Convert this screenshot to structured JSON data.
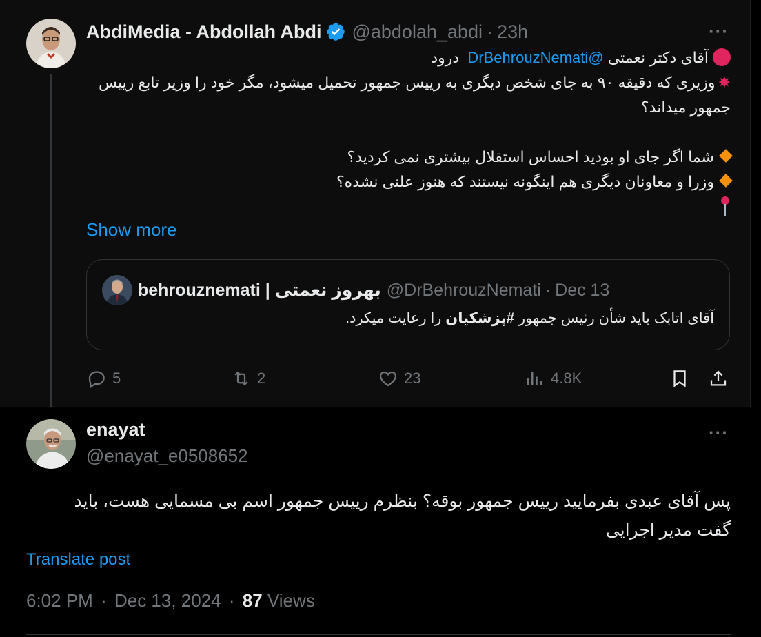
{
  "tweet": {
    "author_name": "AbdiMedia - Abdollah Abdi",
    "handle": "@abdolah_abdi",
    "separator": "·",
    "time": "23h",
    "more": "···",
    "mention": "@DrBehrouzNemati",
    "line1": "آقای دکتر نعمتی",
    "line1_end": "درود",
    "line2": "وزیری که دقیقه ۹۰ به جای شخص دیگری به رییس جمهور تحمیل میشود، مگر خود را وزیر تابع رییس جمهور میداند؟",
    "bullet1": "شما اگر جای او بودید احساس استقلال بیشتری نمی کردید؟",
    "bullet2": "وزرا و معاونان دیگری هم اینگونه نیستند که هنوز علنی نشده؟",
    "show_more": "Show more",
    "quote": {
      "author_name": "behrouznemati | بهروز نعمتی",
      "handle": "@DrBehrouzNemati",
      "separator": "·",
      "date": "Dec 13",
      "text_before": "آقای اتابک باید شأن رئیس جمهور",
      "hashtag": "#پزشکیان",
      "text_after": "را رعایت میکرد."
    },
    "actions": {
      "replies": "5",
      "reposts": "2",
      "likes": "23",
      "views": "4.8K"
    }
  },
  "reply": {
    "author_name": "enayat",
    "handle": "@enayat_e0508652",
    "more": "···",
    "text": "پس آقای عبدی بفرمایید رییس جمهور بوقه؟ بنظرم رییس جمهور اسم بی مسمایی هست، باید گفت مدیر اجرایی",
    "translate": "Translate post",
    "time": "6:02 PM",
    "separator": "·",
    "date": "Dec 13, 2024",
    "views_count": "87",
    "views_label": "Views"
  },
  "colors": {
    "accent": "#1d9bf0",
    "muted": "#71767b",
    "text": "#e7e9ea",
    "background": "#000000"
  }
}
